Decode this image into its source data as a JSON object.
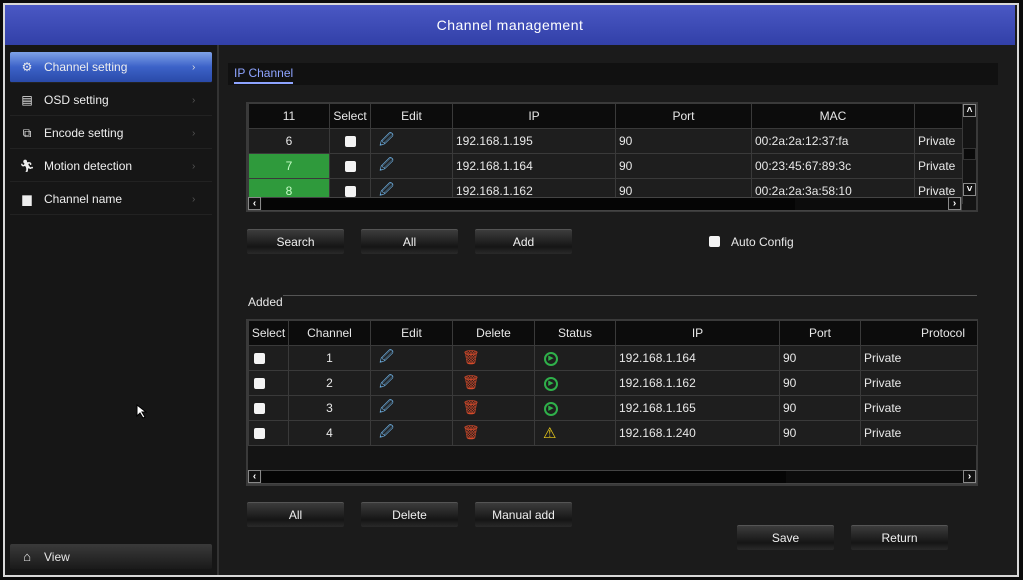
{
  "header": {
    "title": "Channel management"
  },
  "sidebar": {
    "items": [
      {
        "label": "Channel setting",
        "icon": "gears-icon",
        "active": true
      },
      {
        "label": "OSD setting",
        "icon": "osd-icon"
      },
      {
        "label": "Encode setting",
        "icon": "encode-icon"
      },
      {
        "label": "Motion detection",
        "icon": "running-man-icon"
      },
      {
        "label": "Channel name",
        "icon": "document-icon"
      }
    ],
    "view_label": "View"
  },
  "tab": "IP Channel",
  "search_table": {
    "headers": [
      "11",
      "Select",
      "Edit",
      "IP",
      "Port",
      "MAC",
      ""
    ],
    "rows": [
      {
        "ch": "6",
        "ip": "192.168.1.195",
        "port": "90",
        "mac": "00:2a:2a:12:37:fa",
        "protocol": "Private",
        "highlight": false
      },
      {
        "ch": "7",
        "ip": "192.168.1.164",
        "port": "90",
        "mac": "00:23:45:67:89:3c",
        "protocol": "Private",
        "highlight": true
      },
      {
        "ch": "8",
        "ip": "192.168.1.162",
        "port": "90",
        "mac": "00:2a:2a:3a:58:10",
        "protocol": "Private",
        "highlight": true
      }
    ]
  },
  "search_buttons": {
    "search": "Search",
    "all": "All",
    "add": "Add"
  },
  "auto_config": {
    "label": "Auto Config",
    "checked": false
  },
  "added": {
    "label": "Added",
    "headers": [
      "Select",
      "Channel",
      "Edit",
      "Delete",
      "Status",
      "IP",
      "Port",
      "Protocol"
    ],
    "rows": [
      {
        "channel": "1",
        "status": "play",
        "ip": "192.168.1.164",
        "port": "90",
        "protocol": "Private"
      },
      {
        "channel": "2",
        "status": "play",
        "ip": "192.168.1.162",
        "port": "90",
        "protocol": "Private"
      },
      {
        "channel": "3",
        "status": "play",
        "ip": "192.168.1.165",
        "port": "90",
        "protocol": "Private"
      },
      {
        "channel": "4",
        "status": "warning",
        "ip": "192.168.1.240",
        "port": "90",
        "protocol": "Private"
      }
    ]
  },
  "added_buttons": {
    "all": "All",
    "delete": "Delete",
    "manual_add": "Manual add"
  },
  "footer": {
    "save": "Save",
    "return": "Return"
  },
  "colors": {
    "header": "#3a4ab8",
    "highlight_green": "#2f9a3c",
    "tab_accent": "#8ea4ff"
  }
}
